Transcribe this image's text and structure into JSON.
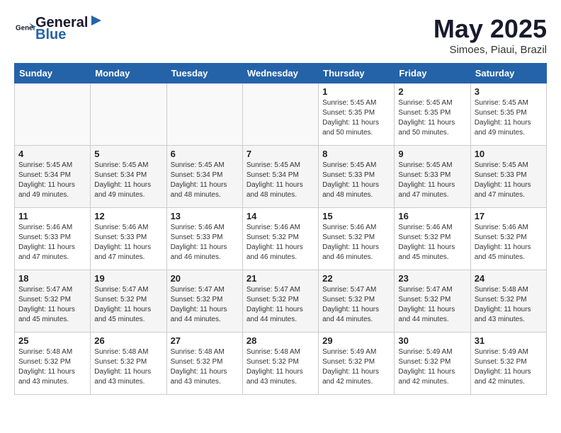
{
  "logo": {
    "text_general": "General",
    "text_blue": "Blue"
  },
  "title": "May 2025",
  "subtitle": "Simoes, Piaui, Brazil",
  "days_of_week": [
    "Sunday",
    "Monday",
    "Tuesday",
    "Wednesday",
    "Thursday",
    "Friday",
    "Saturday"
  ],
  "weeks": [
    [
      {
        "day": "",
        "info": ""
      },
      {
        "day": "",
        "info": ""
      },
      {
        "day": "",
        "info": ""
      },
      {
        "day": "",
        "info": ""
      },
      {
        "day": "1",
        "info": "Sunrise: 5:45 AM\nSunset: 5:35 PM\nDaylight: 11 hours\nand 50 minutes."
      },
      {
        "day": "2",
        "info": "Sunrise: 5:45 AM\nSunset: 5:35 PM\nDaylight: 11 hours\nand 50 minutes."
      },
      {
        "day": "3",
        "info": "Sunrise: 5:45 AM\nSunset: 5:35 PM\nDaylight: 11 hours\nand 49 minutes."
      }
    ],
    [
      {
        "day": "4",
        "info": "Sunrise: 5:45 AM\nSunset: 5:34 PM\nDaylight: 11 hours\nand 49 minutes."
      },
      {
        "day": "5",
        "info": "Sunrise: 5:45 AM\nSunset: 5:34 PM\nDaylight: 11 hours\nand 49 minutes."
      },
      {
        "day": "6",
        "info": "Sunrise: 5:45 AM\nSunset: 5:34 PM\nDaylight: 11 hours\nand 48 minutes."
      },
      {
        "day": "7",
        "info": "Sunrise: 5:45 AM\nSunset: 5:34 PM\nDaylight: 11 hours\nand 48 minutes."
      },
      {
        "day": "8",
        "info": "Sunrise: 5:45 AM\nSunset: 5:33 PM\nDaylight: 11 hours\nand 48 minutes."
      },
      {
        "day": "9",
        "info": "Sunrise: 5:45 AM\nSunset: 5:33 PM\nDaylight: 11 hours\nand 47 minutes."
      },
      {
        "day": "10",
        "info": "Sunrise: 5:45 AM\nSunset: 5:33 PM\nDaylight: 11 hours\nand 47 minutes."
      }
    ],
    [
      {
        "day": "11",
        "info": "Sunrise: 5:46 AM\nSunset: 5:33 PM\nDaylight: 11 hours\nand 47 minutes."
      },
      {
        "day": "12",
        "info": "Sunrise: 5:46 AM\nSunset: 5:33 PM\nDaylight: 11 hours\nand 47 minutes."
      },
      {
        "day": "13",
        "info": "Sunrise: 5:46 AM\nSunset: 5:33 PM\nDaylight: 11 hours\nand 46 minutes."
      },
      {
        "day": "14",
        "info": "Sunrise: 5:46 AM\nSunset: 5:32 PM\nDaylight: 11 hours\nand 46 minutes."
      },
      {
        "day": "15",
        "info": "Sunrise: 5:46 AM\nSunset: 5:32 PM\nDaylight: 11 hours\nand 46 minutes."
      },
      {
        "day": "16",
        "info": "Sunrise: 5:46 AM\nSunset: 5:32 PM\nDaylight: 11 hours\nand 45 minutes."
      },
      {
        "day": "17",
        "info": "Sunrise: 5:46 AM\nSunset: 5:32 PM\nDaylight: 11 hours\nand 45 minutes."
      }
    ],
    [
      {
        "day": "18",
        "info": "Sunrise: 5:47 AM\nSunset: 5:32 PM\nDaylight: 11 hours\nand 45 minutes."
      },
      {
        "day": "19",
        "info": "Sunrise: 5:47 AM\nSunset: 5:32 PM\nDaylight: 11 hours\nand 45 minutes."
      },
      {
        "day": "20",
        "info": "Sunrise: 5:47 AM\nSunset: 5:32 PM\nDaylight: 11 hours\nand 44 minutes."
      },
      {
        "day": "21",
        "info": "Sunrise: 5:47 AM\nSunset: 5:32 PM\nDaylight: 11 hours\nand 44 minutes."
      },
      {
        "day": "22",
        "info": "Sunrise: 5:47 AM\nSunset: 5:32 PM\nDaylight: 11 hours\nand 44 minutes."
      },
      {
        "day": "23",
        "info": "Sunrise: 5:47 AM\nSunset: 5:32 PM\nDaylight: 11 hours\nand 44 minutes."
      },
      {
        "day": "24",
        "info": "Sunrise: 5:48 AM\nSunset: 5:32 PM\nDaylight: 11 hours\nand 43 minutes."
      }
    ],
    [
      {
        "day": "25",
        "info": "Sunrise: 5:48 AM\nSunset: 5:32 PM\nDaylight: 11 hours\nand 43 minutes."
      },
      {
        "day": "26",
        "info": "Sunrise: 5:48 AM\nSunset: 5:32 PM\nDaylight: 11 hours\nand 43 minutes."
      },
      {
        "day": "27",
        "info": "Sunrise: 5:48 AM\nSunset: 5:32 PM\nDaylight: 11 hours\nand 43 minutes."
      },
      {
        "day": "28",
        "info": "Sunrise: 5:48 AM\nSunset: 5:32 PM\nDaylight: 11 hours\nand 43 minutes."
      },
      {
        "day": "29",
        "info": "Sunrise: 5:49 AM\nSunset: 5:32 PM\nDaylight: 11 hours\nand 42 minutes."
      },
      {
        "day": "30",
        "info": "Sunrise: 5:49 AM\nSunset: 5:32 PM\nDaylight: 11 hours\nand 42 minutes."
      },
      {
        "day": "31",
        "info": "Sunrise: 5:49 AM\nSunset: 5:32 PM\nDaylight: 11 hours\nand 42 minutes."
      }
    ]
  ]
}
